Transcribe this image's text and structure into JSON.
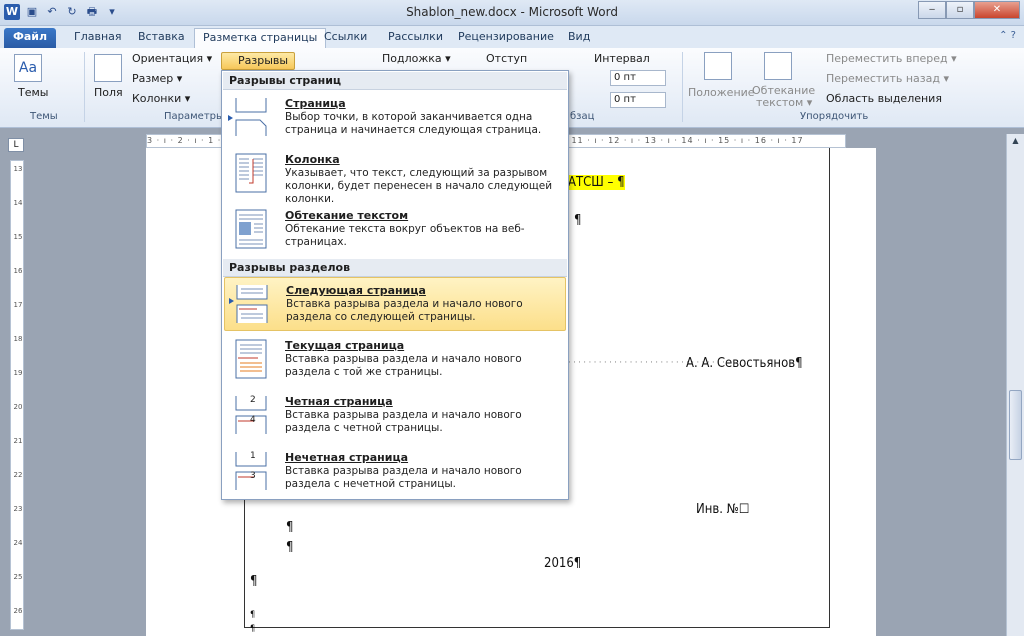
{
  "window": {
    "title": "Shablon_new.docx - Microsoft Word",
    "minimize": "‒",
    "maximize": "▫",
    "close": "✕"
  },
  "qat": {
    "word": "W",
    "save": "▣",
    "undo": "↶",
    "redo": "↻",
    "preview": "🖶",
    "customize": "▾"
  },
  "tabs": [
    {
      "label": "Файл"
    },
    {
      "label": "Главная"
    },
    {
      "label": "Вставка"
    },
    {
      "label": "Разметка страницы"
    },
    {
      "label": "Ссылки"
    },
    {
      "label": "Рассылки"
    },
    {
      "label": "Рецензирование"
    },
    {
      "label": "Вид"
    }
  ],
  "help": "⌃ ?",
  "ribbon": {
    "themes": {
      "btn": "Темы",
      "group": "Темы",
      "icon": "Aa"
    },
    "page_setup": {
      "fields": "Поля",
      "orientation": "Ориентация ▾",
      "size": "Размер ▾",
      "columns": "Колонки ▾",
      "breaks": "Разрывы ▾",
      "group": "Параметры"
    },
    "background": {
      "watermark": "Подложка ▾"
    },
    "paragraph": {
      "indent": "Отступ",
      "spacing": "Интервал",
      "before": "0 пт",
      "after": "0 пт",
      "group": "бзац"
    },
    "arrange": {
      "position": "Положение",
      "wrap1": "Обтекание",
      "wrap2": "текстом ▾",
      "forward": "Переместить вперед ▾",
      "backward": "Переместить назад ▾",
      "selection": "Область выделения",
      "group": "Упорядочить"
    }
  },
  "ruler": {
    "corner": "L",
    "hticks": "3 · ı · 2 · ı · 1 · ı ·    · ı · 1 · ı · 2 · ı · 3 · ı · 4 · ı · 5 · ı · 6 · ı · 7 · ı · 8 · ı · 9 · ı · 10 · ı · 11 · ı · 12 · ı · 13 · ı · 14 · ı · 15 · ı · 16 · ı · 17",
    "vticks": [
      "13",
      "14",
      "15",
      "16",
      "17",
      "18",
      "19",
      "20",
      "21",
      "22",
      "23",
      "24",
      "25",
      "26"
    ]
  },
  "document": {
    "line1": "АТСШ – ¶",
    "line2": "¶",
    "line3": "А. А. Севостьянов¶",
    "line4": "Инв. №☐",
    "line5": "¶",
    "line6": "¶",
    "line7": "2016¶",
    "line8": "¶",
    "line9": "¶",
    "line10": "¶",
    "dots": "· · · · · · · · · · · · · · · · · · · · · · · · · · · · · · ·"
  },
  "menu": {
    "section1": "Разрывы страниц",
    "section2": "Разрывы разделов",
    "items": [
      {
        "title": "Страница",
        "desc": "Выбор точки, в которой заканчивается одна страница и начинается следующая страница."
      },
      {
        "title": "Колонка",
        "desc": "Указывает, что текст, следующий за разрывом колонки, будет перенесен в начало следующей колонки."
      },
      {
        "title": "Обтекание текстом",
        "desc": "Обтекание текста вокруг объектов на веб-страницах."
      },
      {
        "title": "Следующая страница",
        "desc": "Вставка разрыва раздела и начало нового раздела со следующей страницы."
      },
      {
        "title": "Текущая страница",
        "desc": "Вставка разрыва раздела и начало нового раздела с той же страницы."
      },
      {
        "title": "Четная страница",
        "desc": "Вставка разрыва раздела и начало нового раздела с четной страницы."
      },
      {
        "title": "Нечетная страница",
        "desc": "Вставка разрыва раздела и начало нового раздела с нечетной страницы."
      }
    ],
    "num2": "2",
    "num4": "4",
    "num1": "1",
    "num3": "3"
  },
  "colors": {
    "accent": "#2a5cad",
    "hover": "#fcdf8a",
    "highlight": "#ffff00"
  }
}
